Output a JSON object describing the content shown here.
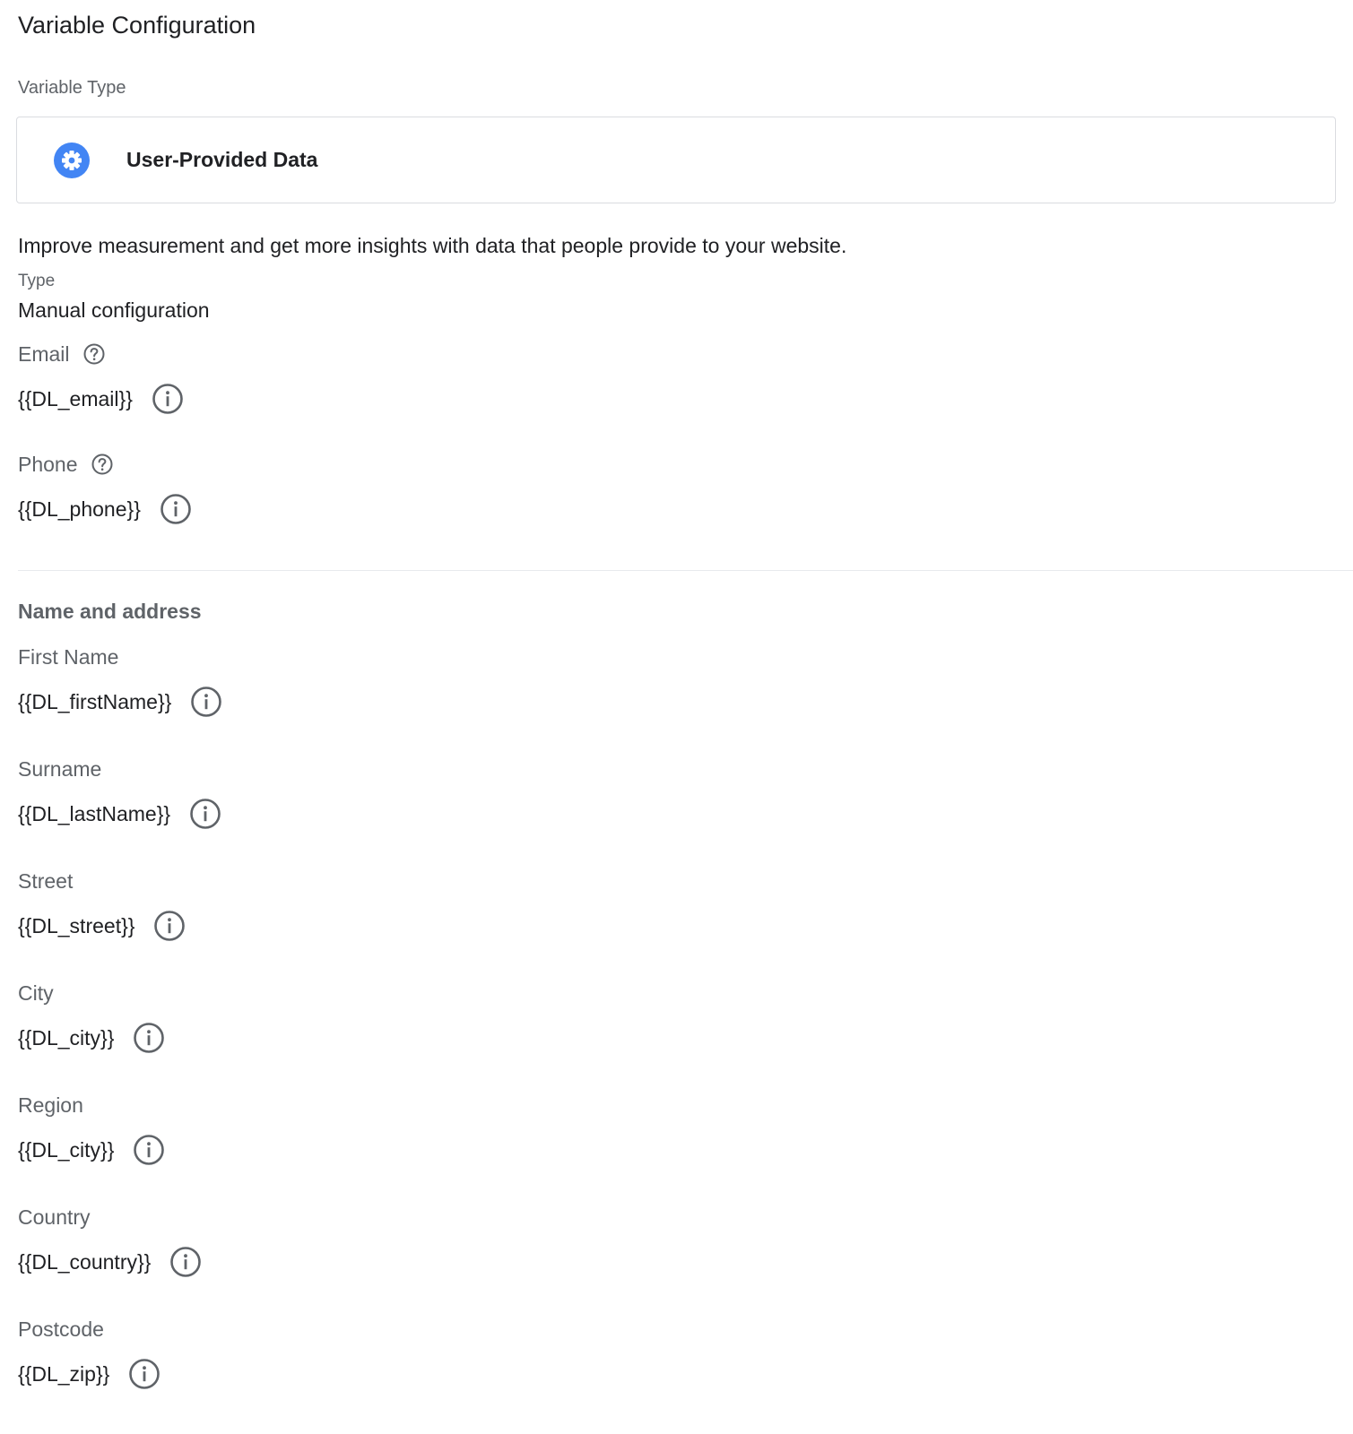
{
  "header": {
    "title": "Variable Configuration"
  },
  "variable_type": {
    "label": "Variable Type",
    "selected": "User-Provided Data",
    "icon": "settings-gear-icon",
    "icon_color": "#4285f4"
  },
  "description": "Improve measurement and get more insights with data that people provide to your website.",
  "config_type": {
    "label": "Type",
    "value": "Manual configuration"
  },
  "contact_fields": [
    {
      "label": "Email",
      "value": "{{DL_email}}"
    },
    {
      "label": "Phone",
      "value": "{{DL_phone}}"
    }
  ],
  "address_section": {
    "heading": "Name and address",
    "fields": [
      {
        "label": "First Name",
        "value": "{{DL_firstName}}"
      },
      {
        "label": "Surname",
        "value": "{{DL_lastName}}"
      },
      {
        "label": "Street",
        "value": "{{DL_street}}"
      },
      {
        "label": "City",
        "value": "{{DL_city}}"
      },
      {
        "label": "Region",
        "value": "{{DL_city}}"
      },
      {
        "label": "Country",
        "value": "{{DL_country}}"
      },
      {
        "label": "Postcode",
        "value": "{{DL_zip}}"
      }
    ]
  }
}
